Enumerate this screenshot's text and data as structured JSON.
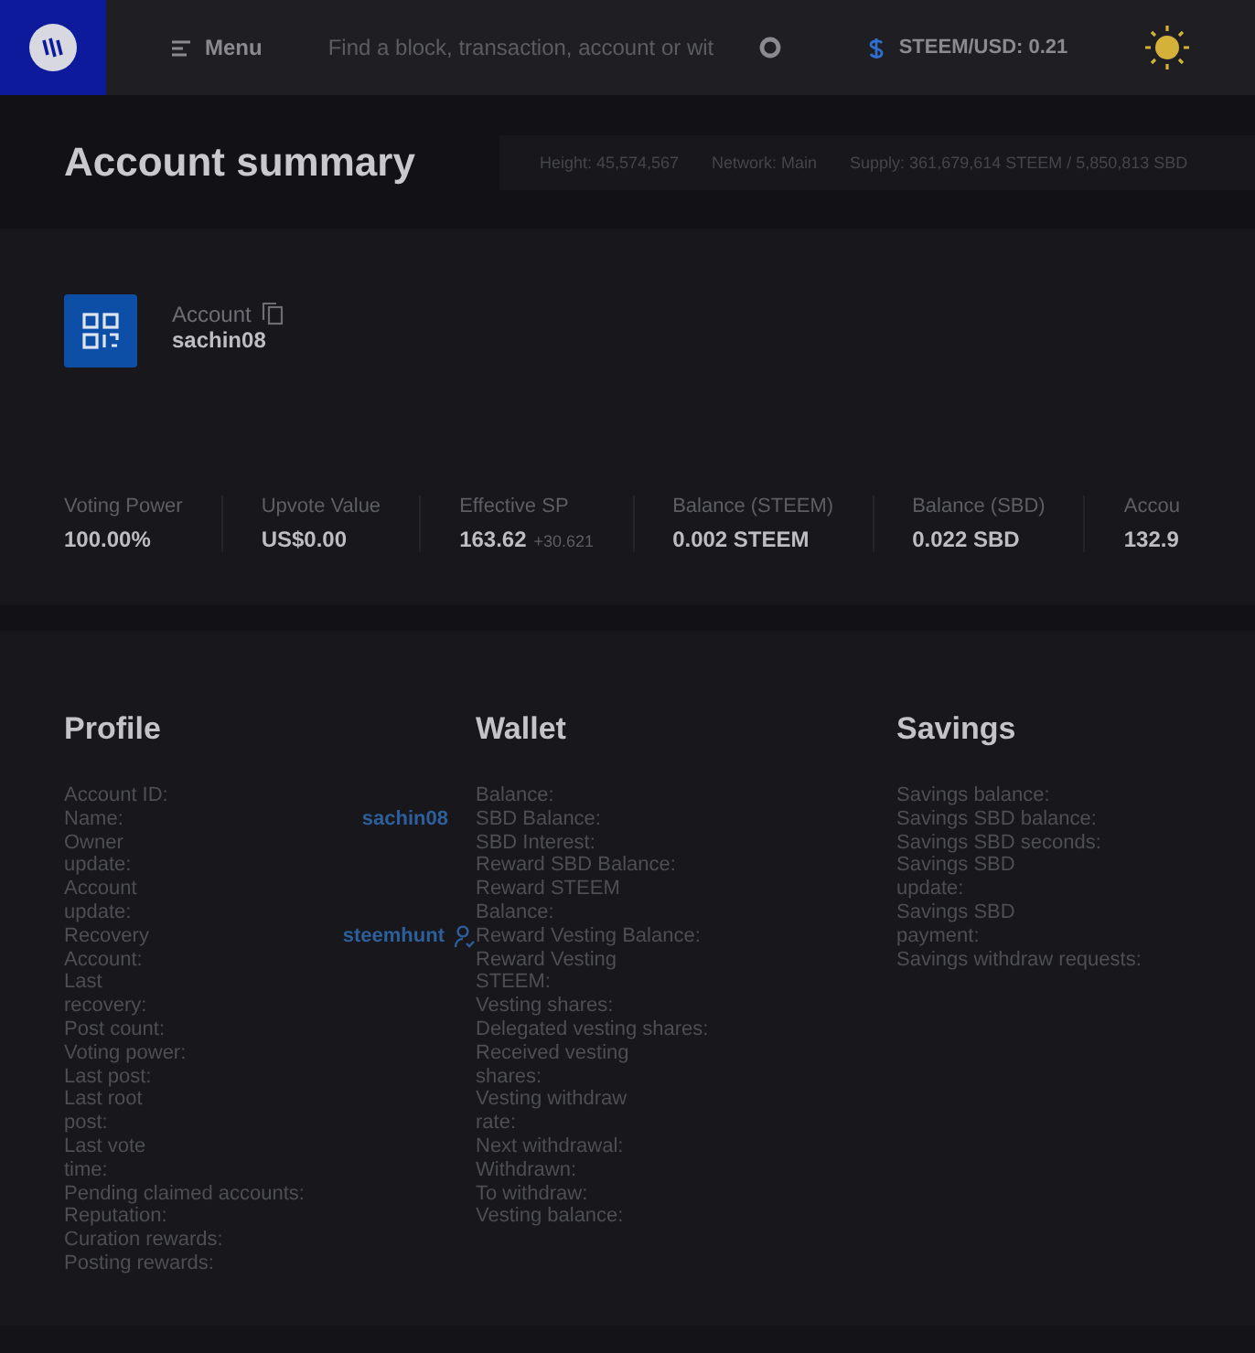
{
  "header": {
    "menu_label": "Menu",
    "search": {
      "placeholder": "Find a block, transaction, account or wit"
    },
    "price": "STEEM/USD: 0.21"
  },
  "summary": {
    "title": "Account summary",
    "stats": [
      "Height: 45,574,567",
      "Network: Main",
      "Supply: 361,679,614 STEEM / 5,850,813 SBD"
    ]
  },
  "account": {
    "label": "Account",
    "name": "sachin08"
  },
  "metrics": [
    {
      "label": "Voting Power",
      "value": "100.00%"
    },
    {
      "label": "Upvote Value",
      "value": "US$0.00"
    },
    {
      "label": "Effective SP",
      "value": "163.62",
      "delta": "+30.621"
    },
    {
      "label": "Balance (STEEM)",
      "value": "0.002 STEEM"
    },
    {
      "label": "Balance (SBD)",
      "value": "0.022 SBD"
    },
    {
      "label": "Accou",
      "value": "132.9"
    }
  ],
  "sections": [
    {
      "title": "Profile",
      "rows": [
        {
          "label": "Account ID:"
        },
        {
          "label": "Name:",
          "value": "sachin08"
        },
        {
          "label": "Owner update:",
          "wrap": true
        },
        {
          "label": "Account update:",
          "wrap": true
        },
        {
          "label": "Recovery Account:",
          "value": "steemhunt",
          "verified": true,
          "wrap": true
        },
        {
          "label": "Last recovery:",
          "wrap": true
        },
        {
          "label": "Post count:"
        },
        {
          "label": "Voting power:"
        },
        {
          "label": "Last post:"
        },
        {
          "label": "Last root post:",
          "wrap": true
        },
        {
          "label": "Last vote time:",
          "wrap": true
        },
        {
          "label": "Pending claimed accounts:"
        },
        {
          "label": "Reputation:"
        },
        {
          "label": "Curation rewards:"
        },
        {
          "label": "Posting rewards:"
        }
      ]
    },
    {
      "title": "Wallet",
      "rows": [
        {
          "label": "Balance:"
        },
        {
          "label": "SBD Balance:"
        },
        {
          "label": "SBD Interest:"
        },
        {
          "label": "Reward SBD Balance:"
        },
        {
          "label": "Reward STEEM Balance:",
          "wrap": true
        },
        {
          "label": "Reward Vesting Balance:"
        },
        {
          "label": "Reward Vesting STEEM:",
          "wrap": true
        },
        {
          "label": "Vesting shares:"
        },
        {
          "label": "Delegated vesting shares:"
        },
        {
          "label": "Received vesting shares:",
          "wrap": true
        },
        {
          "label": "Vesting withdraw rate:",
          "wrap": true
        },
        {
          "label": "Next withdrawal:",
          "wrap": true
        },
        {
          "label": "Withdrawn:"
        },
        {
          "label": "To withdraw:"
        },
        {
          "label": "Vesting balance:"
        }
      ]
    },
    {
      "title": "Savings",
      "rows": [
        {
          "label": "Savings balance:"
        },
        {
          "label": "Savings SBD balance:"
        },
        {
          "label": "Savings SBD seconds:"
        },
        {
          "label": "Savings SBD update:",
          "wrap": true
        },
        {
          "label": "Savings SBD payment:",
          "wrap": true
        },
        {
          "label": "Savings withdraw requests:"
        }
      ]
    }
  ]
}
